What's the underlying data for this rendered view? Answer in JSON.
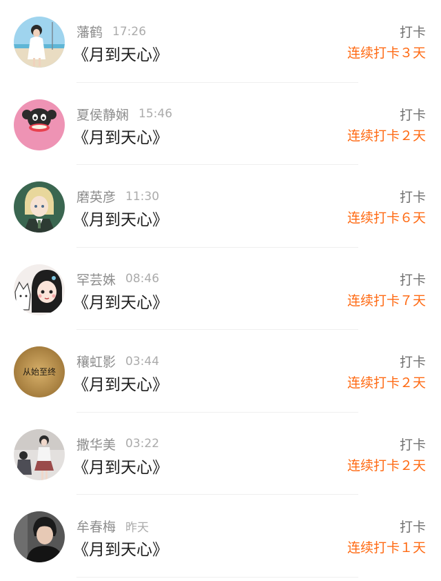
{
  "feed": {
    "items": [
      {
        "name": "藩鹤",
        "time": "17:26",
        "book": "《月到天心》",
        "action": "打卡",
        "streak": "连续打卡３天",
        "avatar_icon": "girl-beach-avatar-icon",
        "avatar_color": "#8fc9e6"
      },
      {
        "name": "夏侯静娴",
        "time": "15:46",
        "book": "《月到天心》",
        "action": "打卡",
        "streak": "连续打卡２天",
        "avatar_icon": "monkey-avatar-icon",
        "avatar_color": "#ee93b4"
      },
      {
        "name": "磨英彦",
        "time": "11:30",
        "book": "《月到天心》",
        "action": "打卡",
        "streak": "连续打卡６天",
        "avatar_icon": "anime-boy-avatar-icon",
        "avatar_color": "#3a6650"
      },
      {
        "name": "罕芸姝",
        "time": "08:46",
        "book": "《月到天心》",
        "action": "打卡",
        "streak": "连续打卡７天",
        "avatar_icon": "cartoon-girl-cat-avatar-icon",
        "avatar_color": "#f1ecea"
      },
      {
        "name": "穰虹影",
        "time": "03:44",
        "book": "《月到天心》",
        "action": "打卡",
        "streak": "连续打卡２天",
        "avatar_icon": "text-badge-avatar-icon",
        "avatar_color": "#b88e45",
        "avatar_text": "从始至终"
      },
      {
        "name": "撒华美",
        "time": "03:22",
        "book": "《月到天心》",
        "action": "打卡",
        "streak": "连续打卡２天",
        "avatar_icon": "couple-photo-avatar-icon",
        "avatar_color": "#d9d6d4"
      },
      {
        "name": "牟春梅",
        "time": "昨天",
        "book": "《月到天心》",
        "action": "打卡",
        "streak": "连续打卡１天",
        "avatar_icon": "boy-portrait-avatar-icon",
        "avatar_color": "#3a3a3a"
      }
    ]
  }
}
